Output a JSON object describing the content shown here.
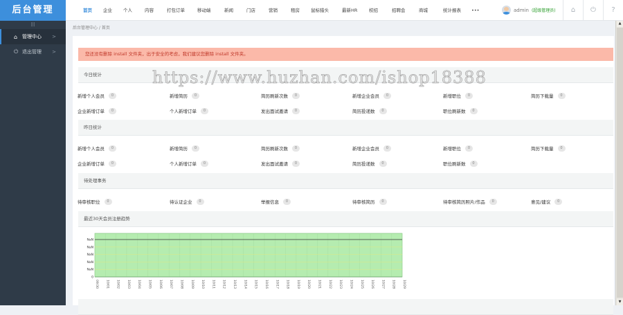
{
  "app": {
    "title": "后台管理"
  },
  "sidebar": {
    "collapse": "|||",
    "items": [
      {
        "label": "管理中心",
        "icon": "home-icon",
        "active": true
      },
      {
        "label": "退出管理",
        "icon": "power-icon"
      }
    ]
  },
  "topnav": {
    "items": [
      "首页",
      "企业",
      "个人",
      "内容",
      "打包订单",
      "移动端",
      "新闻",
      "门店",
      "营销",
      "租房",
      "鼠标猎头",
      "最新HR",
      "校招",
      "招聘会",
      "商城",
      "统计报表",
      "•••"
    ],
    "user": {
      "name": "admin",
      "role": "(超级管理员)"
    }
  },
  "breadcrumb": "后台管理中心 / 首页",
  "alert": "您还没有删除 install 文件夹，出于安全的考虑，我们建议您删除 install 文件夹。",
  "watermark": "https://www.huzhan.com/ishop18388",
  "sections": {
    "today": {
      "title": "今日统计",
      "stats": [
        {
          "label": "新增个人会员",
          "value": "0"
        },
        {
          "label": "新增简历",
          "value": "0"
        },
        {
          "label": "简历刷新次数",
          "value": "0"
        },
        {
          "label": "新增企业会员",
          "value": "0"
        },
        {
          "label": "新增职位",
          "value": "0"
        },
        {
          "label": "简历下载量",
          "value": "0"
        },
        {
          "label": "企业新增订单",
          "value": "0"
        },
        {
          "label": "个人新增订单",
          "value": "0"
        },
        {
          "label": "发出面试邀请",
          "value": "0"
        },
        {
          "label": "简历投递数",
          "value": "0"
        },
        {
          "label": "职位刷新数",
          "value": "0"
        }
      ]
    },
    "yesterday": {
      "title": "昨日统计",
      "stats": [
        {
          "label": "新增个人会员",
          "value": "0"
        },
        {
          "label": "新增简历",
          "value": "0"
        },
        {
          "label": "简历刷新次数",
          "value": "0"
        },
        {
          "label": "新增企业会员",
          "value": "0"
        },
        {
          "label": "新增职位",
          "value": "0"
        },
        {
          "label": "简历下载量",
          "value": "0"
        },
        {
          "label": "企业新增订单",
          "value": "0"
        },
        {
          "label": "个人新增订单",
          "value": "0"
        },
        {
          "label": "发出面试邀请",
          "value": "0"
        },
        {
          "label": "简历投递数",
          "value": "0"
        },
        {
          "label": "职位刷新数",
          "value": "0"
        }
      ]
    },
    "pending": {
      "title": "待处理事务",
      "stats": [
        {
          "label": "待审核职位",
          "value": "0"
        },
        {
          "label": "待认证企业",
          "value": "0"
        },
        {
          "label": "举报信息",
          "value": "0"
        },
        {
          "label": "待审核简历",
          "value": "0"
        },
        {
          "label": "待审核简历照片/作品",
          "value": "0"
        },
        {
          "label": "意见/建议",
          "value": "0"
        }
      ]
    },
    "chart": {
      "title": "最近30天会员注册趋势"
    }
  },
  "chart_data": {
    "type": "area",
    "title": "最近30天会员注册趋势",
    "y_tick_labels": [
      "0",
      "NaN",
      "NaN",
      "NaN",
      "NaN",
      "NaN"
    ],
    "categories": [
      "09/30",
      "10/01",
      "10/02",
      "10/03",
      "10/04",
      "10/05",
      "10/06",
      "10/07",
      "10/08",
      "10/09",
      "10/10",
      "10/11",
      "10/12",
      "10/13",
      "10/14",
      "10/15",
      "10/16",
      "10/17",
      "10/18",
      "10/19",
      "10/20",
      "10/21",
      "10/22",
      "10/23",
      "10/24",
      "10/25",
      "10/26",
      "10/27",
      "10/28",
      "10/29"
    ],
    "values": [
      0,
      0,
      0,
      0,
      0,
      0,
      0,
      0,
      0,
      0,
      0,
      0,
      0,
      0,
      0,
      0,
      0,
      0,
      0,
      0,
      0,
      0,
      0,
      0,
      0,
      0,
      0,
      0,
      0,
      0
    ],
    "fill": "#b5ecb0",
    "grid": true
  }
}
